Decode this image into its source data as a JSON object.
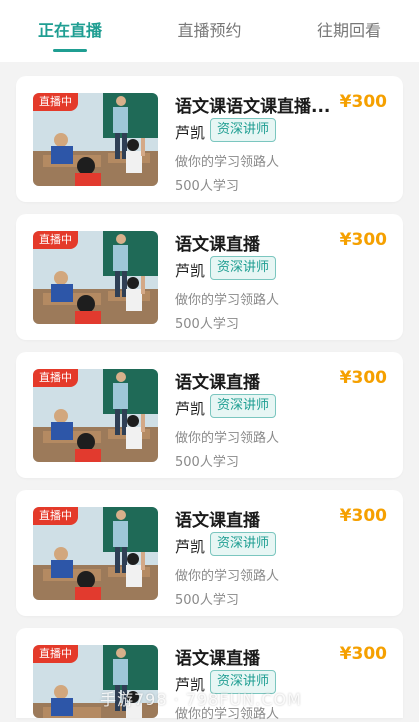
{
  "tabs": [
    {
      "label": "正在直播"
    },
    {
      "label": "直播预约"
    },
    {
      "label": "往期回看"
    }
  ],
  "cards": [
    {
      "badge": "直播中",
      "title": "语文课语文课直播...",
      "price": "¥300",
      "teacher": "芦凯",
      "teacher_badge": "资深讲师",
      "desc": "做你的学习领路人",
      "count": "500人学习"
    },
    {
      "badge": "直播中",
      "title": "语文课直播",
      "price": "¥300",
      "teacher": "芦凯",
      "teacher_badge": "资深讲师",
      "desc": "做你的学习领路人",
      "count": "500人学习"
    },
    {
      "badge": "直播中",
      "title": "语文课直播",
      "price": "¥300",
      "teacher": "芦凯",
      "teacher_badge": "资深讲师",
      "desc": "做你的学习领路人",
      "count": "500人学习"
    },
    {
      "badge": "直播中",
      "title": "语文课直播",
      "price": "¥300",
      "teacher": "芦凯",
      "teacher_badge": "资深讲师",
      "desc": "做你的学习领路人",
      "count": "500人学习"
    },
    {
      "badge": "直播中",
      "title": "语文课直播",
      "price": "¥300",
      "teacher": "芦凯",
      "teacher_badge": "资深讲师",
      "desc": "做你的学习领路人",
      "count": ""
    }
  ],
  "watermark": "手游798 · 798FUN.COM",
  "colors": {
    "accent": "#1f9e92",
    "price": "#f5a000",
    "live_badge": "#e43a2a",
    "background": "#f3f3f3"
  }
}
